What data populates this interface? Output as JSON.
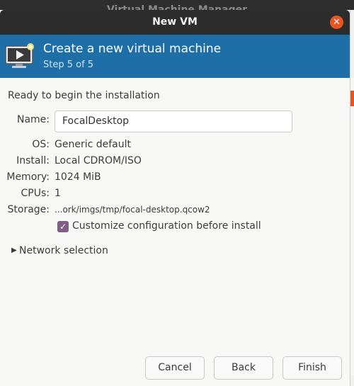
{
  "background_window": {
    "title": "Virtual Machine Manager"
  },
  "dialog": {
    "title": "New VM",
    "close_icon": "close-icon",
    "banner": {
      "icon": "vm-monitor-icon",
      "heading": "Create a new virtual machine",
      "step": "Step 5 of 5"
    },
    "ready_text": "Ready to begin the installation",
    "fields": {
      "name_label": "Name:",
      "name_value": "FocalDesktop",
      "os_label": "OS:",
      "os_value": "Generic default",
      "install_label": "Install:",
      "install_value": "Local CDROM/ISO",
      "memory_label": "Memory:",
      "memory_value": "1024 MiB",
      "cpus_label": "CPUs:",
      "cpus_value": "1",
      "storage_label": "Storage:",
      "storage_value": "...ork/imgs/tmp/focal-desktop.qcow2"
    },
    "customize_checkbox": {
      "label": "Customize configuration before install",
      "checked": true
    },
    "network_expander": {
      "label": "Network selection",
      "expanded": false
    },
    "buttons": {
      "cancel": "Cancel",
      "back": "Back",
      "finish": "Finish"
    }
  },
  "colors": {
    "banner": "#1e6fa8",
    "titlebar": "#2c2c2c",
    "close_button": "#e95420",
    "checkbox": "#7e5e89"
  }
}
